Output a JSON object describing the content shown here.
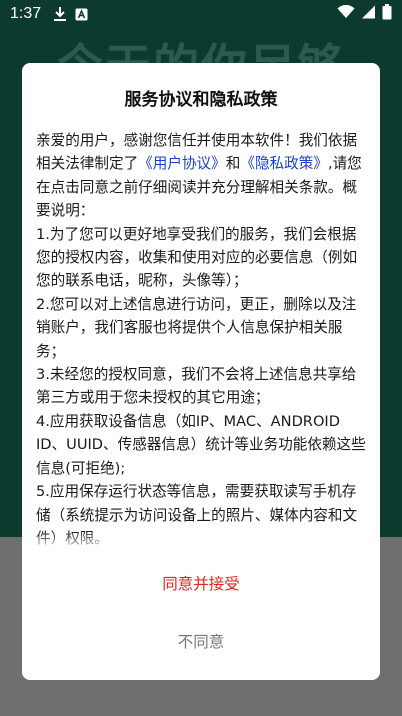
{
  "status_bar": {
    "time": "1:37",
    "icons_left": [
      "download-icon",
      "a-badge-icon"
    ],
    "icons_right": [
      "wifi-icon",
      "signal-icon",
      "battery-icon"
    ]
  },
  "background": {
    "title": "今天的你足够"
  },
  "dialog": {
    "title": "服务协议和隐私政策",
    "intro_part1": "亲爱的用户，感谢您信任并使用本软件！我们依据相关法律制定了",
    "link_user_agreement": "《用户协议》",
    "and": "和",
    "link_privacy_policy": "《隐私政策》",
    "intro_part2": ",请您在点击同意之前仔细阅读并充分理解相关条款。概要说明：",
    "items": [
      "1.为了您可以更好地享受我们的服务，我们会根据您的授权内容，收集和使用对应的必要信息（例如您的联系电话，昵称，头像等）；",
      "2.您可以对上述信息进行访问，更正，删除以及注销账户，我们客服也将提供个人信息保护相关服务；",
      "3.未经您的授权同意，我们不会将上述信息共享给第三方或用于您未授权的其它用途；",
      "4.应用获取设备信息（如IP、MAC、ANDROID ID、UUID、传感器信息）统计等业务功能依赖这些信息(可拒绝);",
      "5.应用保存运行状态等信息，需要获取读写手机存储（系统提示为访问设备上的照片、媒体内容和文件）权限。"
    ],
    "accept_label": "同意并接受",
    "reject_label": "不同意"
  },
  "colors": {
    "accept": "#e8231f",
    "link": "#1a3fd1",
    "reject": "#777777"
  }
}
